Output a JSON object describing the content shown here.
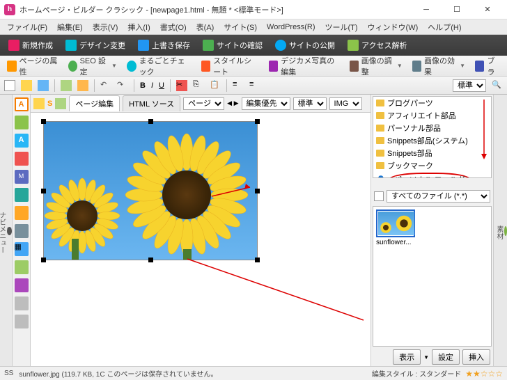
{
  "window": {
    "title": "ホームページ・ビルダー クラシック - [newpage1.html - 無題 * <標準モード>]"
  },
  "menu": {
    "file": "ファイル(F)",
    "edit": "編集(E)",
    "view": "表示(V)",
    "insert": "挿入(I)",
    "format": "書式(O)",
    "table": "表(A)",
    "site": "サイト(S)",
    "wordpress": "WordPress(R)",
    "tool": "ツール(T)",
    "window": "ウィンドウ(W)",
    "help": "ヘルプ(H)"
  },
  "toolbar1": {
    "new": "新規作成",
    "design": "デザイン変更",
    "save": "上書き保存",
    "sitecheck": "サイトの確認",
    "publish": "サイトの公開",
    "access": "アクセス解析"
  },
  "toolbar2": {
    "pageprops": "ページの属性",
    "seo": "SEO 設定",
    "marugoto": "まるごとチェック",
    "stylesheet": "スタイルシート",
    "digicam": "デジカメ写真の編集",
    "imageadjust": "画像の調整",
    "imageeffect": "画像の効果",
    "extra": "ブラ"
  },
  "toolbar3": {
    "style_select": "標準"
  },
  "canvas_tabs": {
    "pageedit": "ページ編集",
    "htmlsource": "HTML ソース",
    "page": "ページ",
    "editpriority": "編集優先",
    "standard": "標準",
    "img": "IMG"
  },
  "tree": {
    "items": [
      "ブログパーツ",
      "アフィリエイト部品",
      "パーソナル部品",
      "Snippets部品(システム)",
      "Snippets部品",
      "ブックマーク"
    ],
    "highlighted": "パーソナル フォルダ"
  },
  "filefilter": "すべてのファイル (*.*)",
  "thumbnail": {
    "label": "sunflower..."
  },
  "rbuttons": {
    "view": "表示",
    "settings": "設定",
    "insert": "挿入"
  },
  "navlabel": "ナビメニュー",
  "rightlabel": "素材",
  "status": {
    "ss": "SS",
    "file": "sunflower.jpg (119.7 KB, 1C このページは保存されていません。",
    "style": "編集スタイル : スタンダード"
  }
}
